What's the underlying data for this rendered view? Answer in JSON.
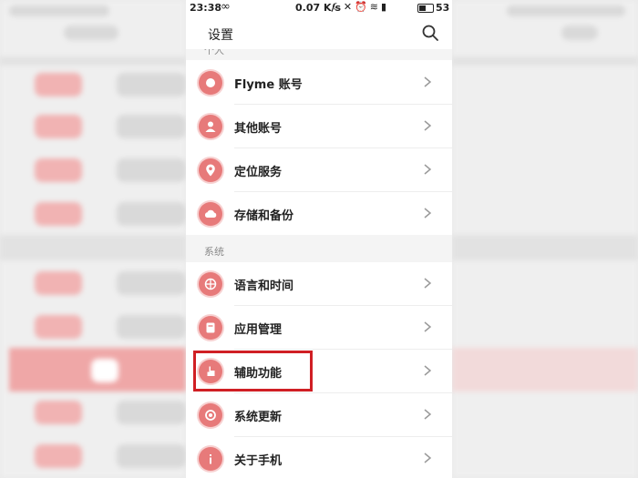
{
  "statusbar": {
    "time": "23:38",
    "speed": "0.07 K/s",
    "battery": "53",
    "battery_level": 0.53
  },
  "header": {
    "title": "设置"
  },
  "sections": {
    "personal": {
      "label": "个人"
    },
    "system": {
      "label": "系统"
    }
  },
  "items": {
    "flyme": {
      "label": "Flyme 账号",
      "icon": "flyme-icon"
    },
    "other": {
      "label": "其他账号",
      "icon": "user-icon"
    },
    "location": {
      "label": "定位服务",
      "icon": "location-pin-icon"
    },
    "storage": {
      "label": "存储和备份",
      "icon": "cloud-icon"
    },
    "language": {
      "label": "语言和时间",
      "icon": "globe-icon"
    },
    "apps": {
      "label": "应用管理",
      "icon": "app-manage-icon"
    },
    "accessibility": {
      "label": "辅助功能",
      "icon": "hand-icon"
    },
    "update": {
      "label": "系统更新",
      "icon": "update-icon"
    },
    "about": {
      "label": "关于手机",
      "icon": "info-icon"
    }
  },
  "colors": {
    "accent": "#e77a7a",
    "highlight": "#d01f24"
  }
}
